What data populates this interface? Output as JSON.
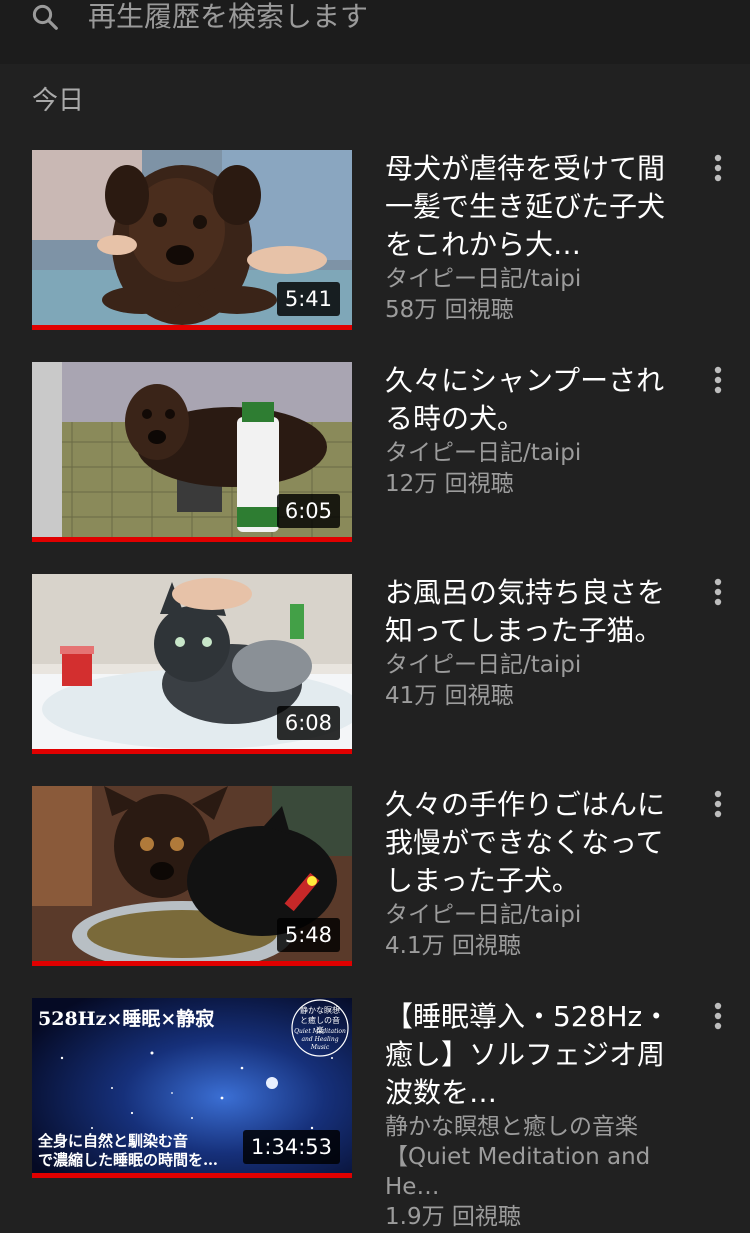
{
  "search": {
    "placeholder": "再生履歴を検索します",
    "icon": "search-icon"
  },
  "section": {
    "label": "今日"
  },
  "videos": [
    {
      "title": "母犬が虐待を受けて間一髪で生き延びた子犬をこれから大…",
      "channel": "タイピー日記/taipi",
      "views": "58万 回視聴",
      "duration": "5:41",
      "watched_fraction": 1.0,
      "thumb_theme": "brown-puppy"
    },
    {
      "title": "久々にシャンプーされる時の犬。",
      "channel": "タイピー日記/taipi",
      "views": "12万 回視聴",
      "duration": "6:05",
      "watched_fraction": 1.0,
      "thumb_theme": "dog-shampoo"
    },
    {
      "title": "お風呂の気持ち良さを知ってしまった子猫。",
      "channel": "タイピー日記/taipi",
      "views": "41万 回視聴",
      "duration": "6:08",
      "watched_fraction": 1.0,
      "thumb_theme": "kitten-bath"
    },
    {
      "title": "久々の手作りごはんに我慢ができなくなってしまった子犬。",
      "channel": "タイピー日記/taipi",
      "views": "4.1万 回視聴",
      "duration": "5:48",
      "watched_fraction": 1.0,
      "thumb_theme": "dog-and-cat-bowl"
    },
    {
      "title": "【睡眠導入・528Hz・癒し】ソルフェジオ周波数を…",
      "channel": "静かな瞑想と癒しの音楽【Quiet Meditation and He…",
      "views": "1.9万 回視聴",
      "duration": "1:34:53",
      "watched_fraction": 1.0,
      "thumb_theme": "starry-sky",
      "thumb_text": {
        "top": "528Hz×睡眠×静寂",
        "badge": "静かな瞑想と癒しの音楽",
        "badge_en": "Quiet Meditation and Healing Music",
        "bottom_line1": "全身に自然と馴染む音",
        "bottom_line2": "で濃縮した睡眠の時間を…"
      }
    }
  ],
  "colors": {
    "background": "#212121",
    "progress": "#e00000",
    "secondary_text": "#9c9c9c"
  }
}
